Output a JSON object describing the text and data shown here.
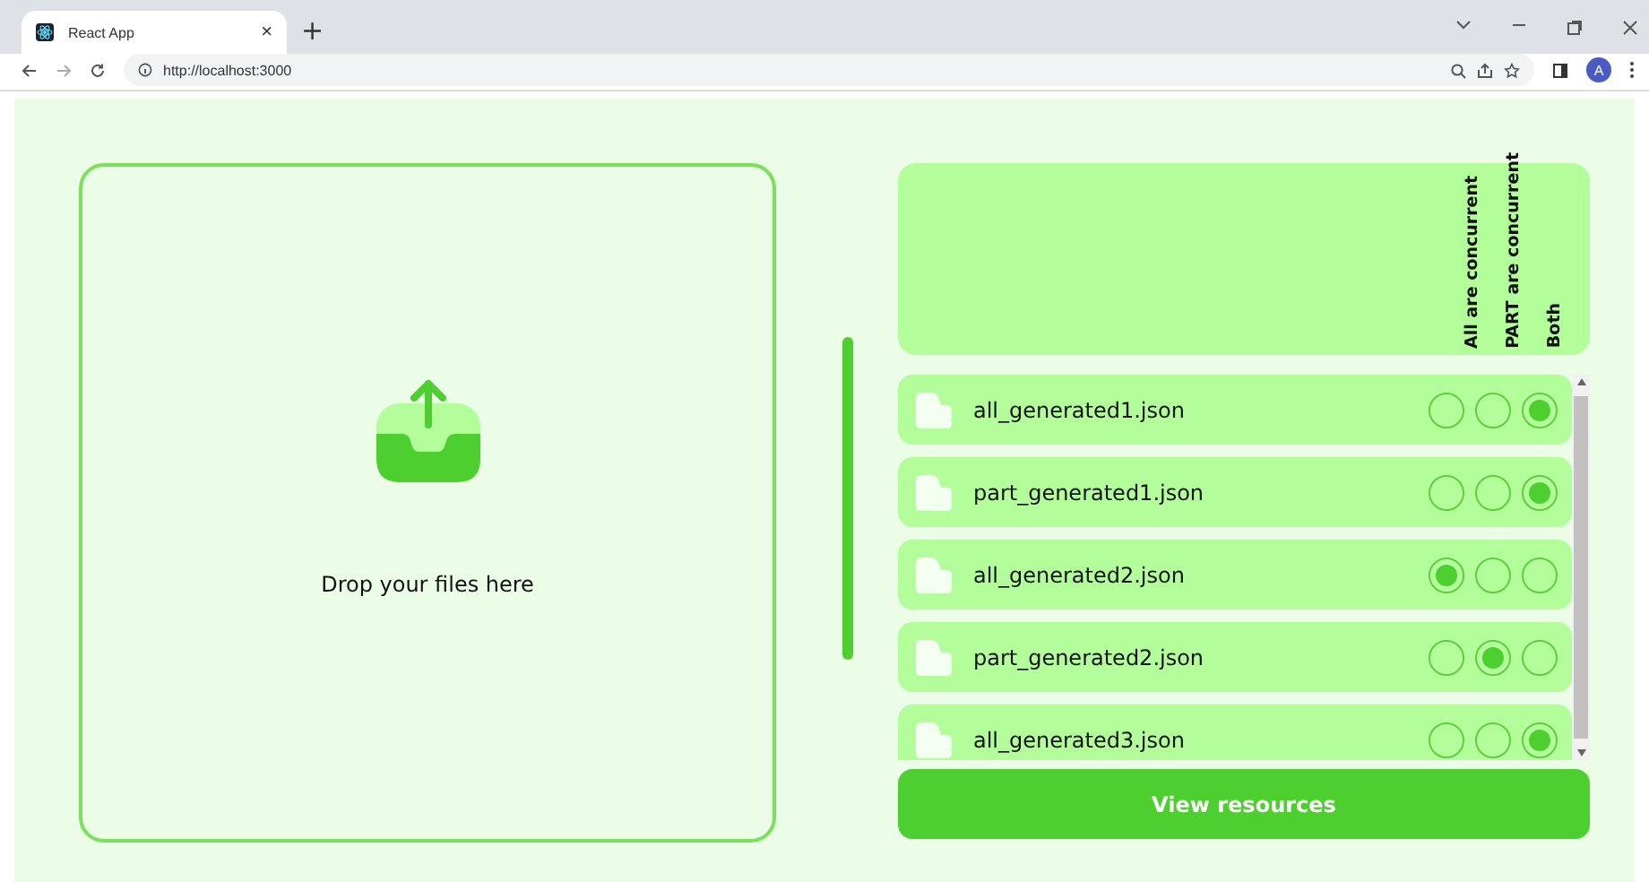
{
  "browser": {
    "tab_title": "React App",
    "new_tab": "+",
    "close_tab": "×",
    "url": "http://localhost:3000",
    "avatar": "A"
  },
  "dropzone": {
    "text": "Drop your files here"
  },
  "table": {
    "columns": [
      "All are concurrent",
      "PART are concurrent",
      "Both"
    ],
    "rows": [
      {
        "name": "all_generated1.json",
        "options": [
          {
            "selected": false
          },
          {
            "selected": false
          },
          {
            "selected": true
          }
        ]
      },
      {
        "name": "part_generated1.json",
        "options": [
          {
            "selected": false
          },
          {
            "selected": false
          },
          {
            "selected": true
          }
        ]
      },
      {
        "name": "all_generated2.json",
        "options": [
          {
            "selected": true
          },
          {
            "selected": false
          },
          {
            "selected": false
          }
        ]
      },
      {
        "name": "part_generated2.json",
        "options": [
          {
            "selected": false
          },
          {
            "selected": true
          },
          {
            "selected": false
          }
        ]
      },
      {
        "name": "all_generated3.json",
        "options": [
          {
            "selected": false
          },
          {
            "selected": false
          },
          {
            "selected": true
          }
        ]
      }
    ]
  },
  "button": "View resources"
}
